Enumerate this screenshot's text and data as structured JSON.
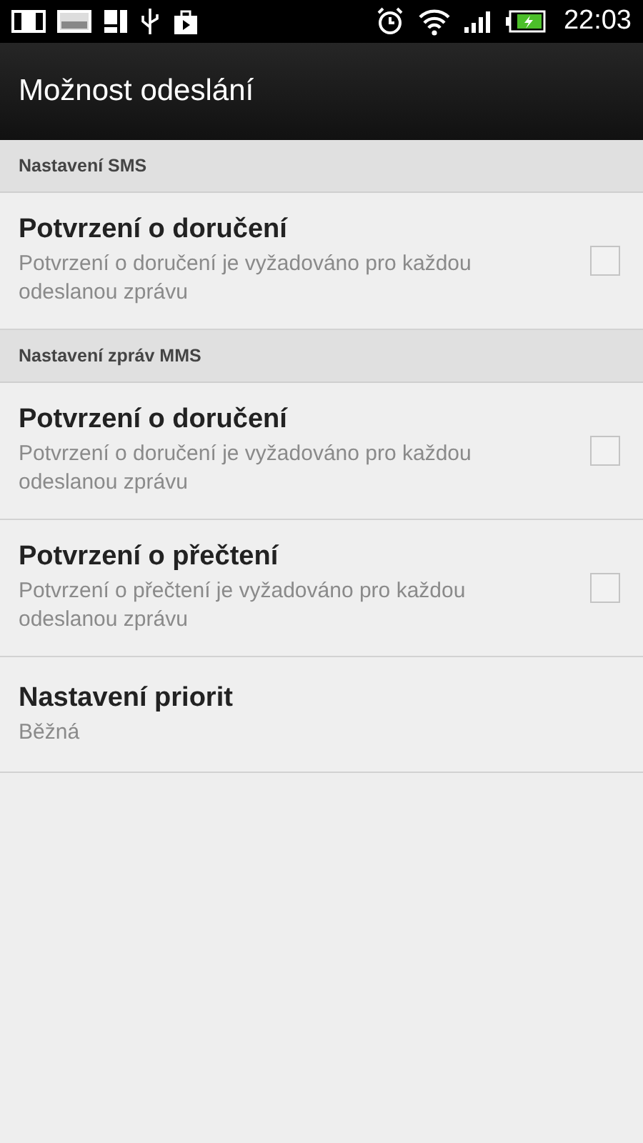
{
  "status_bar": {
    "time": "22:03"
  },
  "title": "Možnost odeslání",
  "sections": [
    {
      "header": "Nastavení SMS",
      "items": [
        {
          "kind": "checkbox",
          "title": "Potvrzení o doručení",
          "summary": "Potvrzení o doručení je vyžadováno pro každou odeslanou zprávu",
          "checked": false
        }
      ]
    },
    {
      "header": "Nastavení zpráv MMS",
      "items": [
        {
          "kind": "checkbox",
          "title": "Potvrzení o doručení",
          "summary": "Potvrzení o doručení je vyžadováno pro každou odeslanou zprávu",
          "checked": false
        },
        {
          "kind": "checkbox",
          "title": "Potvrzení o přečtení",
          "summary": "Potvrzení o přečtení je vyžadováno pro každou odeslanou zprávu",
          "checked": false
        },
        {
          "kind": "value",
          "title": "Nastavení priorit",
          "summary": "Běžná"
        }
      ]
    }
  ]
}
